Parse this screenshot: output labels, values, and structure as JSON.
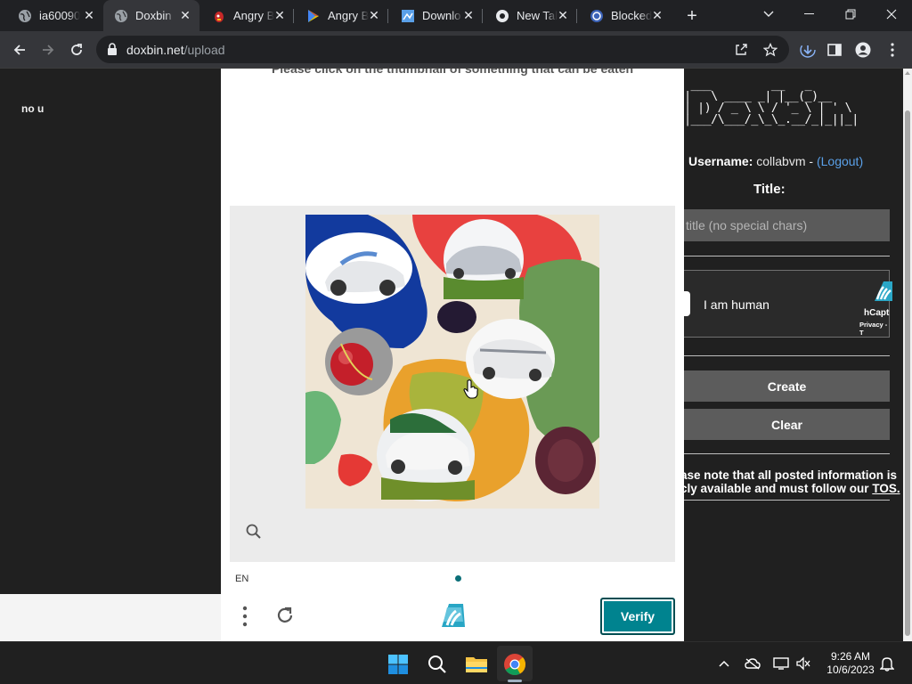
{
  "browser": {
    "tabs": [
      {
        "title": "ia60090",
        "icon": "globe-icon",
        "active": false
      },
      {
        "title": "Doxbin",
        "icon": "globe-icon",
        "active": true
      },
      {
        "title": "Angry B",
        "icon": "angry-birds-icon",
        "active": false
      },
      {
        "title": "Angry B",
        "icon": "play-store-icon",
        "active": false
      },
      {
        "title": "Downlo",
        "icon": "download-site-icon",
        "active": false
      },
      {
        "title": "New Tal",
        "icon": "chrome-icon",
        "active": false
      },
      {
        "title": "Blocked",
        "icon": "blocked-icon",
        "active": false
      }
    ],
    "url_host": "doxbin.net",
    "url_path": "/upload"
  },
  "page": {
    "left_text": "no u",
    "ascii_logo": " ___         __   _\n|   \\ ____ _| |__(_)__ \n| |) / _ \\ \\ / '_ \\ | ' \\\n|___/\\___/_\\_\\_.__/_|_||_|",
    "username_label": "Username:",
    "username": "collabvm",
    "separator": " - ",
    "logout": "(Logout)",
    "title_label": "Title:",
    "title_placeholder": "title (no special chars)",
    "hcaptcha": {
      "label": "I am human",
      "brand": "hCapt",
      "privacy": "Privacy - T"
    },
    "create_label": "Create",
    "clear_label": "Clear",
    "notice_line1": "ase note that all posted information is",
    "notice_line2": "cly available and must follow our ",
    "tos": "TOS."
  },
  "challenge": {
    "prompt": "Please click on the thumbnail of something that can be eaten",
    "language": "EN",
    "verify_label": "Verify",
    "accent_color": "#00838f"
  },
  "taskbar": {
    "time": "9:26 AM",
    "date": "10/6/2023"
  }
}
